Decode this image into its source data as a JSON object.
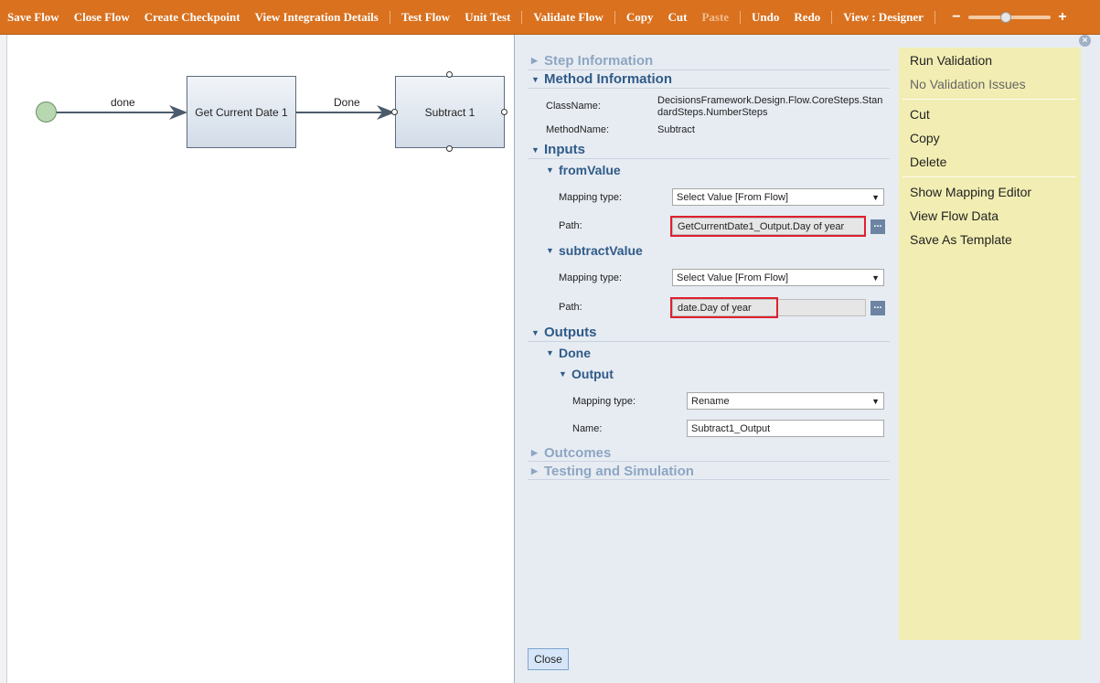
{
  "toolbar": {
    "items": [
      {
        "label": "Save Flow"
      },
      {
        "label": "Close Flow"
      },
      {
        "label": "Create Checkpoint"
      },
      {
        "label": "View Integration Details"
      },
      {
        "label": "Test Flow"
      },
      {
        "label": "Unit Test"
      },
      {
        "label": "Validate Flow"
      },
      {
        "label": "Copy"
      },
      {
        "label": "Cut"
      },
      {
        "label": "Paste"
      },
      {
        "label": "Undo"
      },
      {
        "label": "Redo"
      },
      {
        "label": "View : Designer"
      }
    ],
    "zoom_minus": "−",
    "zoom_plus": "+",
    "zoom_level": 0.45
  },
  "canvas": {
    "edge1_label": "done",
    "edge2_label": "Done",
    "node1_label": "Get Current Date 1",
    "node2_label": "Subtract 1"
  },
  "props": {
    "step_information": "Step Information",
    "method_information": "Method Information",
    "classname_label": "ClassName:",
    "classname_value": "DecisionsFramework.Design.Flow.CoreSteps.StandardSteps.NumberSteps",
    "methodname_label": "MethodName:",
    "methodname_value": "Subtract",
    "inputs": "Inputs",
    "from_value": "fromValue",
    "mapping_type_label": "Mapping type:",
    "path_label": "Path:",
    "from_mapping": "Select Value [From Flow]",
    "from_path": "GetCurrentDate1_Output.Day of year",
    "subtract_value": "subtractValue",
    "sub_mapping": "Select Value [From Flow]",
    "sub_path": "date.Day of year",
    "outputs": "Outputs",
    "done": "Done",
    "output": "Output",
    "out_mapping": "Rename",
    "name_label": "Name:",
    "out_name": "Subtract1_Output",
    "outcomes": "Outcomes",
    "testing": "Testing and Simulation",
    "dots": "...",
    "close": "Close"
  },
  "menu": {
    "run_validation": "Run Validation",
    "no_issues": "No Validation Issues",
    "cut": "Cut",
    "copy": "Copy",
    "delete": "Delete",
    "show_mapping": "Show Mapping Editor",
    "view_flow_data": "View Flow Data",
    "save_template": "Save As Template"
  },
  "colors": {
    "toolbar": "#d9711f",
    "accent": "#2f5b88",
    "highlight": "#e0202d",
    "menu_bg": "#f2eeb3"
  }
}
